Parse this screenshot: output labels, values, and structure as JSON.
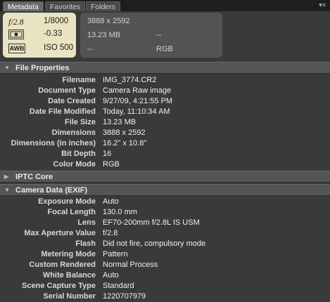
{
  "tabs": [
    "Metadata",
    "Favorites",
    "Folders"
  ],
  "camera_summary": {
    "aperture": "f/2.8",
    "shutter": "1/8000",
    "exposure_comp": "-0.33",
    "wb_label": "AWB",
    "iso": "ISO 500"
  },
  "file_summary": {
    "dimensions": "3888 x 2592",
    "size": "13.23 MB",
    "placeholder_1": "--",
    "placeholder_2": "--",
    "color_mode": "RGB"
  },
  "sections": {
    "file_properties": {
      "title": "File Properties",
      "rows": [
        {
          "label": "Filename",
          "value": "IMG_3774.CR2"
        },
        {
          "label": "Document Type",
          "value": "Camera Raw image"
        },
        {
          "label": "Date Created",
          "value": "9/27/09, 4:21:55 PM"
        },
        {
          "label": "Date File Modified",
          "value": "Today, 11:10:34 AM"
        },
        {
          "label": "File Size",
          "value": "13.23 MB"
        },
        {
          "label": "Dimensions",
          "value": "3888 x 2592"
        },
        {
          "label": "Dimensions (in inches)",
          "value": "16.2\" x 10.8\""
        },
        {
          "label": "Bit Depth",
          "value": "16"
        },
        {
          "label": "Color Mode",
          "value": "RGB"
        }
      ]
    },
    "iptc_core": {
      "title": "IPTC Core"
    },
    "camera_data": {
      "title": "Camera Data (EXIF)",
      "rows": [
        {
          "label": "Exposure Mode",
          "value": "Auto"
        },
        {
          "label": "Focal Length",
          "value": "130.0 mm"
        },
        {
          "label": "Lens",
          "value": "EF70-200mm f/2.8L IS USM"
        },
        {
          "label": "Max Aperture Value",
          "value": "f/2.8"
        },
        {
          "label": "Flash",
          "value": "Did not fire, compulsory mode"
        },
        {
          "label": "Metering Mode",
          "value": "Pattern"
        },
        {
          "label": "Custom Rendered",
          "value": "Normal Process"
        },
        {
          "label": "White Balance",
          "value": "Auto"
        },
        {
          "label": "Scene Capture Type",
          "value": "Standard"
        },
        {
          "label": "Serial Number",
          "value": "1220707979"
        }
      ]
    }
  }
}
